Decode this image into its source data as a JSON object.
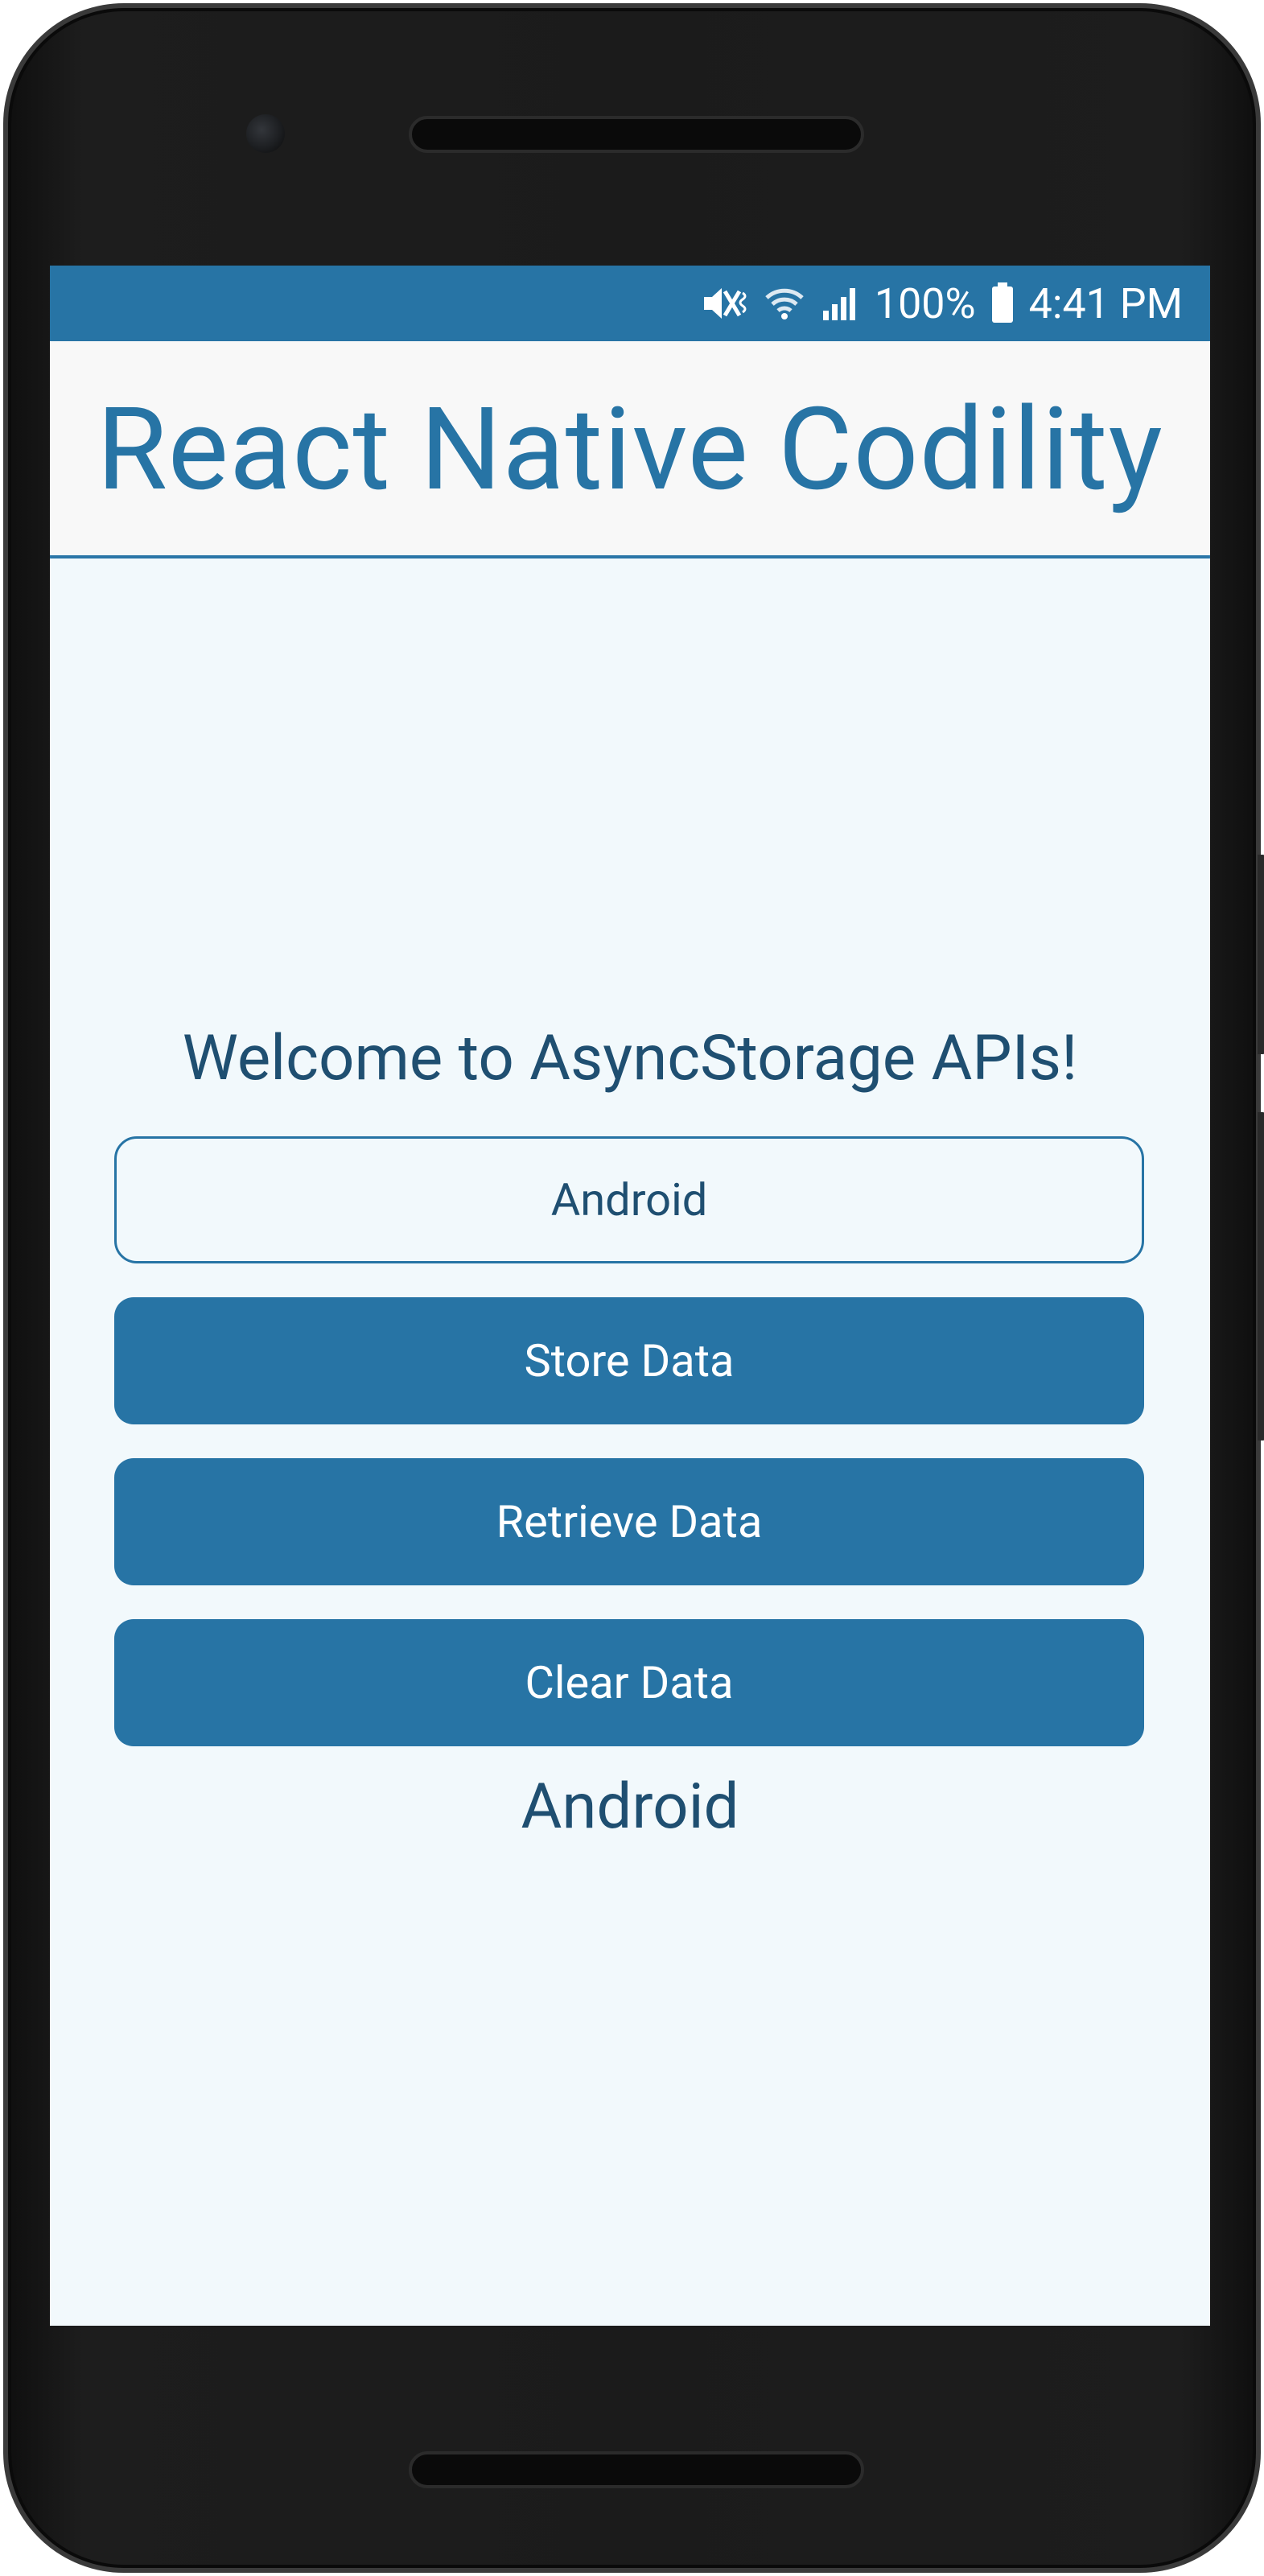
{
  "status_bar": {
    "battery_percent": "100%",
    "time": "4:41 PM",
    "icons": [
      "mute-vibrate-icon",
      "wifi-icon",
      "signal-icon",
      "battery-icon"
    ]
  },
  "app_bar": {
    "title": "React Native Codility"
  },
  "main": {
    "welcome_text": "Welcome to AsyncStorage APIs!",
    "input_value": "Android",
    "buttons": {
      "store": "Store Data",
      "retrieve": "Retrieve Data",
      "clear": "Clear Data"
    },
    "result_text": "Android"
  },
  "colors": {
    "accent": "#2774a5",
    "text_dark": "#1f4f71",
    "screen_bg": "#f2f9fc",
    "appbar_bg": "#f8f8f8"
  }
}
